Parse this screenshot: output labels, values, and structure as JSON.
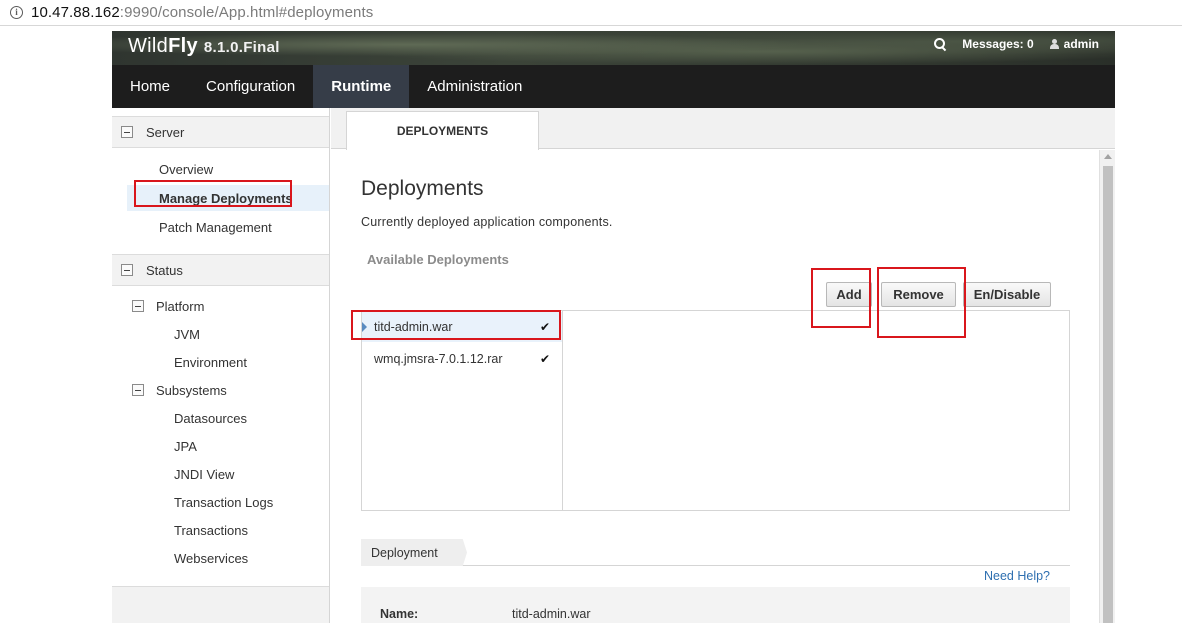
{
  "browser": {
    "url_host": "10.47.88.162",
    "url_rest": ":9990/console/App.html#deployments",
    "info_icon": "info-icon"
  },
  "header": {
    "brand_prefix": "Wild",
    "brand_fly": "Fly",
    "version": "8.1.0.Final",
    "messages": "Messages: 0",
    "user": "admin"
  },
  "nav": {
    "tabs": [
      "Home",
      "Configuration",
      "Runtime",
      "Administration"
    ],
    "active": "Runtime"
  },
  "sidebar": {
    "server_header": "Server",
    "server_items": [
      "Overview",
      "Manage Deployments",
      "Patch Management"
    ],
    "selected": "Manage Deployments",
    "status_header": "Status",
    "platform": "Platform",
    "platform_items": [
      "JVM",
      "Environment"
    ],
    "subsystems": "Subsystems",
    "subsystem_items": [
      "Datasources",
      "JPA",
      "JNDI View",
      "Transaction Logs",
      "Transactions",
      "Webservices"
    ]
  },
  "main": {
    "tab": "DEPLOYMENTS",
    "title": "Deployments",
    "subtitle": "Currently deployed application components.",
    "available_label": "Available Deployments",
    "buttons": {
      "add": "Add",
      "remove": "Remove",
      "enable": "En/Disable"
    },
    "deployments": [
      {
        "name": "titd-admin.war",
        "enabled": "✔"
      },
      {
        "name": "wmq.jmsra-7.0.1.12.rar",
        "enabled": "✔"
      }
    ],
    "detail_tab": "Deployment",
    "help": "Need Help?",
    "detail": {
      "name_label": "Name:",
      "name_value": "titd-admin.war"
    }
  }
}
